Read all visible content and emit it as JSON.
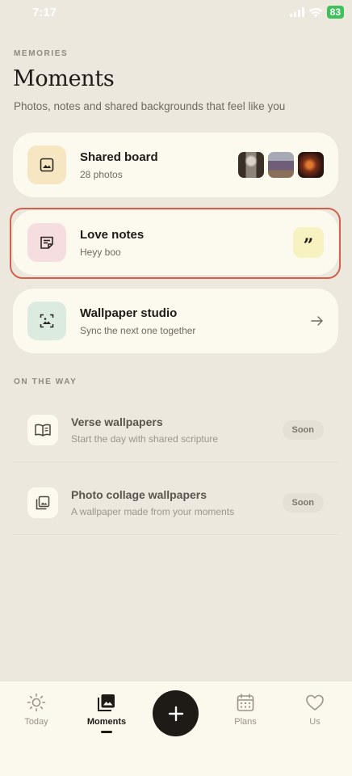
{
  "status_bar": {
    "time": "7:17",
    "battery": "83"
  },
  "header": {
    "eyebrow": "MEMORIES",
    "title": "Moments",
    "subtitle": "Photos, notes and shared backgrounds that feel like you"
  },
  "cards": [
    {
      "title": "Shared board",
      "subtitle": "28 photos",
      "icon": "image-icon"
    },
    {
      "title": "Love notes",
      "subtitle": "Heyy boo",
      "icon": "note-icon",
      "badge": "”"
    },
    {
      "title": "Wallpaper studio",
      "subtitle": "Sync the next one together",
      "icon": "wallpaper-icon"
    }
  ],
  "on_the_way": {
    "label": "ON THE WAY",
    "items": [
      {
        "title": "Verse wallpapers",
        "subtitle": "Start the day with shared scripture",
        "badge": "Soon",
        "icon": "book-icon"
      },
      {
        "title": "Photo collage wallpapers",
        "subtitle": "A wallpaper made from your moments",
        "badge": "Soon",
        "icon": "gallery-icon"
      }
    ]
  },
  "tabs": [
    {
      "label": "Today",
      "icon": "sun-icon"
    },
    {
      "label": "Moments",
      "icon": "photos-icon",
      "active": true
    },
    {
      "label": "Plans",
      "icon": "calendar-icon"
    },
    {
      "label": "Us",
      "icon": "heart-icon"
    }
  ],
  "colors": {
    "background": "#ECE8DE",
    "card": "#FCF9EE",
    "image_tile": "#F6E6C2",
    "note_tile": "#F6DDE0",
    "wallpaper_tile": "#DCEBE0",
    "highlight": "#D2604A"
  }
}
